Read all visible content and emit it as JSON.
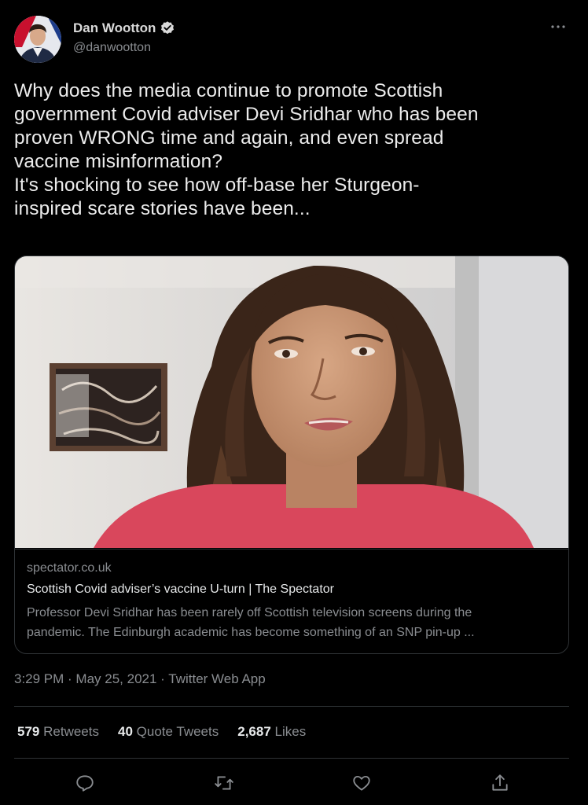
{
  "author": {
    "display_name": "Dan Wootton",
    "handle": "@danwootton",
    "verified_icon": "verified-badge-icon",
    "avatar_icon": "profile-avatar"
  },
  "tweet": {
    "text_lines": [
      "Why does the media continue to promote Scottish",
      "government Covid adviser Devi Sridhar who has been",
      "proven WRONG time and again, and even spread",
      "vaccine misinformation?",
      "It's shocking to see how off-base her Sturgeon-",
      "inspired scare stories have been..."
    ]
  },
  "card": {
    "domain": "spectator.co.uk",
    "title": "Scottish Covid adviser’s vaccine U-turn | The Spectator",
    "description_lines": [
      "Professor Devi Sridhar has been rarely off Scottish television screens during the",
      "pandemic. The Edinburgh academic has become something of an SNP pin-up ..."
    ]
  },
  "meta": {
    "time": "3:29 PM",
    "date": "May 25, 2021",
    "source": "Twitter Web App",
    "separator": " · "
  },
  "stats": {
    "retweets_count": "579",
    "retweets_label": "Retweets",
    "quotes_count": "40",
    "quotes_label": "Quote Tweets",
    "likes_count": "2,687",
    "likes_label": "Likes"
  },
  "actions": [
    "reply-icon",
    "retweet-icon",
    "like-icon",
    "share-icon"
  ],
  "colors": {
    "background": "#000000",
    "text": "#e7e9ea",
    "secondary": "#8a8d91",
    "border": "#2f3336",
    "verified": "#d9d9d9"
  }
}
